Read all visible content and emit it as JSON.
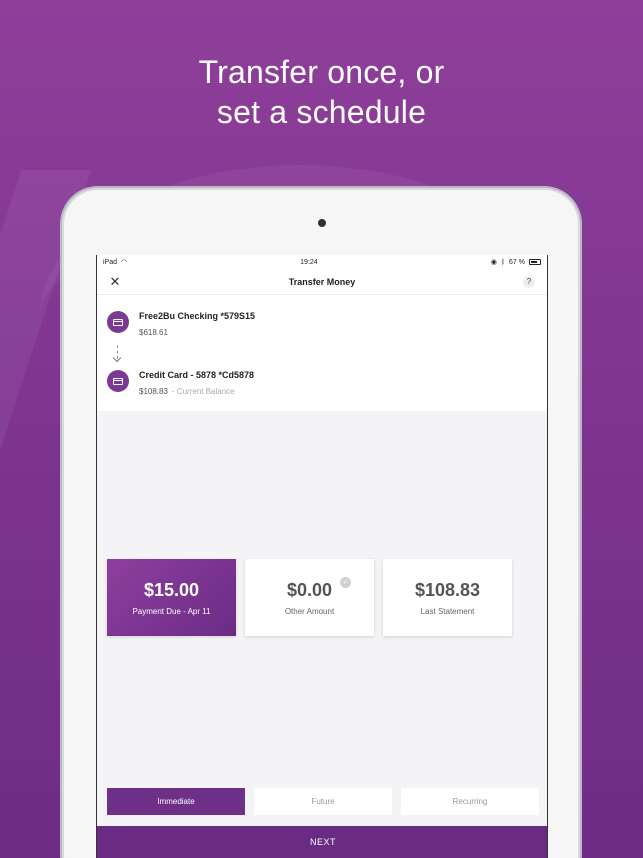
{
  "headline": {
    "line1": "Transfer once, or",
    "line2": "set a schedule"
  },
  "statusbar": {
    "device": "iPad",
    "time": "19:24",
    "battery": "67 %"
  },
  "nav": {
    "title": "Transfer Money",
    "close_icon": "close-icon",
    "help": "?"
  },
  "from_account": {
    "name": "Free2Bu Checking *579S15",
    "balance": "$618.61"
  },
  "to_account": {
    "name": "Credit Card - 5878 *Cd5878",
    "balance": "$108.83",
    "balance_note": "- Current Balance"
  },
  "amounts": [
    {
      "value": "$15.00",
      "label": "Payment Due - Apr 11",
      "selected": true
    },
    {
      "value": "$0.00",
      "label": "Other Amount",
      "selected": false
    },
    {
      "value": "$108.83",
      "label": "Last Statement",
      "selected": false
    }
  ],
  "schedule_tabs": [
    {
      "label": "Immediate",
      "active": true
    },
    {
      "label": "Future",
      "active": false
    },
    {
      "label": "Recurring",
      "active": false
    }
  ],
  "next_label": "NEXT",
  "colors": {
    "accent": "#6e2f88",
    "background": "#8f3f9a"
  }
}
